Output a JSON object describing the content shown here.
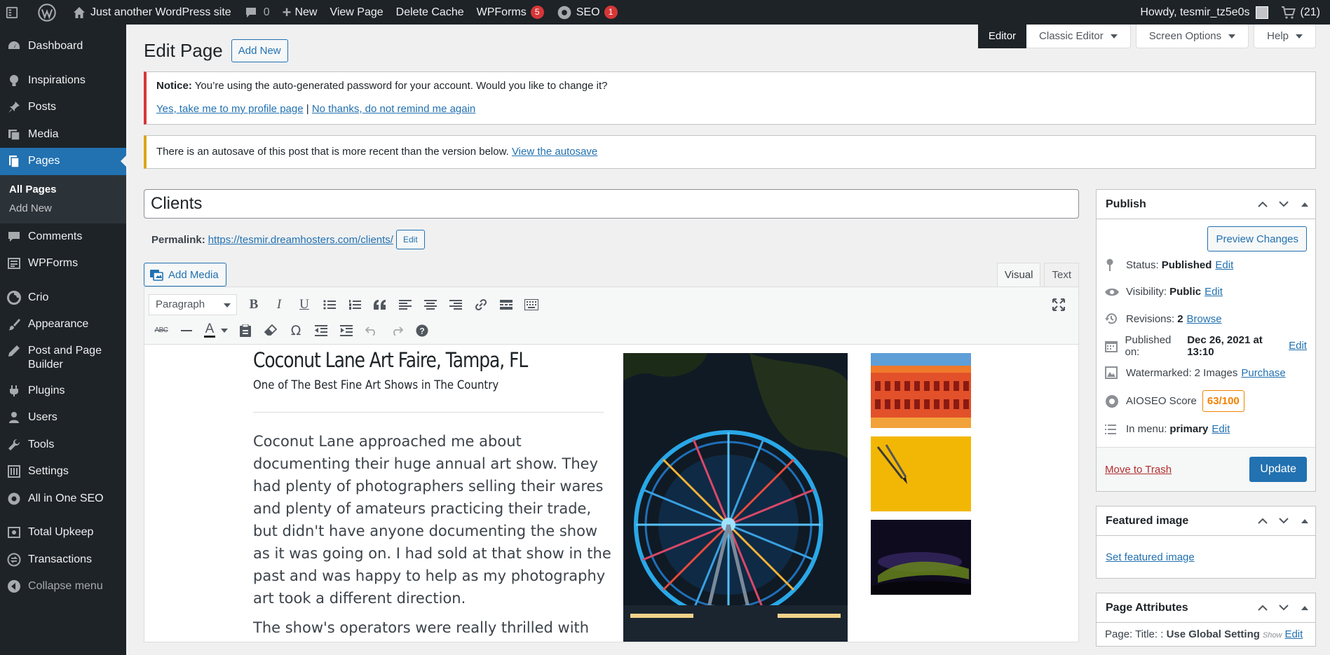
{
  "adminbar": {
    "site_name": "Just another WordPress site",
    "comments_count": "0",
    "new_label": "New",
    "view_page": "View Page",
    "delete_cache": "Delete Cache",
    "wpforms": "WPForms",
    "wpforms_badge": "5",
    "seo": "SEO",
    "seo_badge": "1",
    "howdy": "Howdy, tesmir_tz5e0s",
    "cart_count": "(21)"
  },
  "sidebar": {
    "items": [
      {
        "label": "Dashboard",
        "icon": "dashboard-icon"
      },
      {
        "label": "Inspirations",
        "icon": "lightbulb-icon"
      },
      {
        "label": "Posts",
        "icon": "pushpin-icon"
      },
      {
        "label": "Media",
        "icon": "media-icon"
      },
      {
        "label": "Pages",
        "icon": "pages-icon"
      },
      {
        "label": "Comments",
        "icon": "comment-icon"
      },
      {
        "label": "WPForms",
        "icon": "form-icon"
      },
      {
        "label": "Crio",
        "icon": "crio-icon"
      },
      {
        "label": "Appearance",
        "icon": "paintbrush-icon"
      },
      {
        "label": "Post and Page Builder",
        "icon": "pencil-icon"
      },
      {
        "label": "Plugins",
        "icon": "plugin-icon"
      },
      {
        "label": "Users",
        "icon": "user-icon"
      },
      {
        "label": "Tools",
        "icon": "wrench-icon"
      },
      {
        "label": "Settings",
        "icon": "settings-icon"
      },
      {
        "label": "All in One SEO",
        "icon": "seo-gear-icon"
      },
      {
        "label": "Total Upkeep",
        "icon": "backup-icon"
      },
      {
        "label": "Transactions",
        "icon": "transactions-icon"
      },
      {
        "label": "Collapse menu",
        "icon": "collapse-icon"
      }
    ],
    "submenu": [
      "All Pages",
      "Add New"
    ]
  },
  "screen_meta": {
    "editor": "Editor",
    "classic_editor": "Classic Editor",
    "screen_options": "Screen Options",
    "help": "Help"
  },
  "header": {
    "title": "Edit Page",
    "add_new": "Add New"
  },
  "notices": {
    "password_label": "Notice:",
    "password_text": "You’re using the auto-generated password for your account. Would you like to change it?",
    "yes_link": "Yes, take me to my profile page",
    "separator": "|",
    "no_link": "No thanks, do not remind me again",
    "autosave_text": "There is an autosave of this post that is more recent than the version below.",
    "autosave_link": "View the autosave"
  },
  "editor": {
    "post_title": "Clients",
    "permalink_label": "Permalink:",
    "permalink_url": "https://tesmir.dreamhosters.com/clients/",
    "permalink_edit": "Edit",
    "add_media": "Add Media",
    "tab_visual": "Visual",
    "tab_text": "Text",
    "format_select": "Paragraph"
  },
  "content": {
    "heading": "Coconut Lane Art Faire, Tampa, FL",
    "subheading": "One of The Best Fine Art Shows in The Country",
    "paragraph1": "Coconut Lane approached me about documenting their huge annual art show. They had plenty of photographers selling their wares and plenty of amateurs practicing their trade, but didn't have anyone documenting the show as it was going on. I had sold at that show in the past and was happy to help as my photography art took a different direction.",
    "paragraph2": "The show's operators were really thrilled with the"
  },
  "publish": {
    "title": "Publish",
    "preview": "Preview Changes",
    "status_label": "Status:",
    "status_value": "Published",
    "visibility_label": "Visibility:",
    "visibility_value": "Public",
    "revisions_label": "Revisions:",
    "revisions_value": "2",
    "revisions_link": "Browse",
    "published_label": "Published on:",
    "published_value": "Dec 26, 2021 at 13:10",
    "watermarked_label": "Watermarked:",
    "watermarked_value": "2 Images",
    "watermarked_link": "Purchase",
    "aioseo_label": "AIOSEO Score",
    "aioseo_score": "63/100",
    "menu_label": "In menu:",
    "menu_value": "primary",
    "edit": "Edit",
    "trash": "Move to Trash",
    "update": "Update"
  },
  "featured": {
    "title": "Featured image",
    "set_link": "Set featured image"
  },
  "attributes": {
    "title": "Page Attributes",
    "line_label": "Page: Title: :",
    "line_value": "Use Global Setting",
    "show": "Show",
    "edit": "Edit"
  },
  "colors": {
    "admin_dark": "#1d2327",
    "accent": "#2271b1",
    "notice_error": "#d63638",
    "notice_warning": "#dba617",
    "score_orange": "#f18200"
  }
}
